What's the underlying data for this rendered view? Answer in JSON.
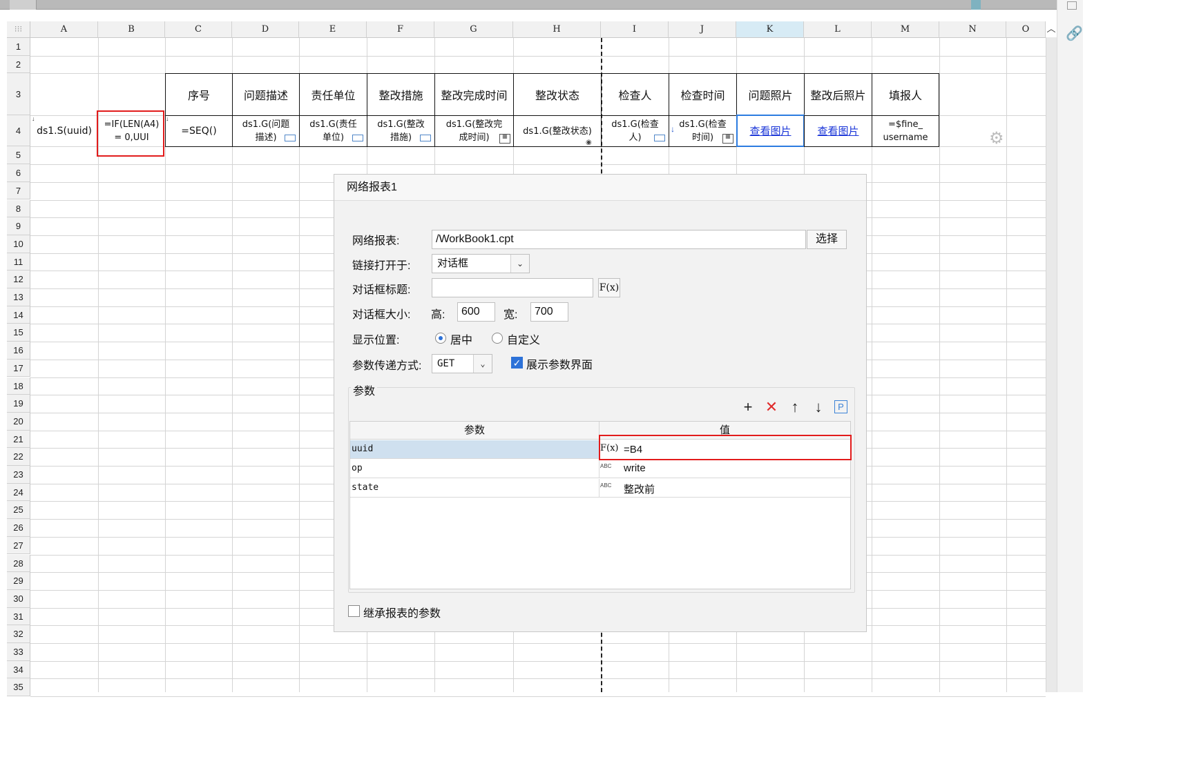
{
  "sheet": {
    "columns": [
      "A",
      "B",
      "C",
      "D",
      "E",
      "F",
      "G",
      "H",
      "I",
      "J",
      "K",
      "L",
      "M",
      "N",
      "O"
    ],
    "rows": [
      "1",
      "2",
      "3",
      "4",
      "5",
      "6",
      "7",
      "8",
      "9",
      "10",
      "11",
      "12",
      "13",
      "14",
      "15",
      "16",
      "17",
      "18",
      "19",
      "20",
      "21",
      "22",
      "23",
      "24",
      "25",
      "26",
      "27",
      "28",
      "29",
      "30",
      "31",
      "32",
      "33",
      "34",
      "35"
    ],
    "header_row": {
      "c": "序号",
      "d": "问题描述",
      "e": "责任单位",
      "f": "整改措施",
      "g": "整改完成时间",
      "h": "整改状态",
      "i": "检查人",
      "j": "检查时间",
      "k": "问题照片",
      "l": "整改后照片",
      "m": "填报人"
    },
    "data_row": {
      "a": "ds1.S(uuid)",
      "b_line1": "=IF(LEN(A4)",
      "b_line2": "= 0,UUI",
      "c": "=SEQ()",
      "d_line1": "ds1.G(问题",
      "d_line2": "描述)",
      "e_line1": "ds1.G(责任",
      "e_line2": "单位)",
      "f_line1": "ds1.G(整改",
      "f_line2": "措施)",
      "g_line1": "ds1.G(整改完",
      "g_line2": "成时间)",
      "h": "ds1.G(整改状态)",
      "i_line1": "ds1.G(检查",
      "i_line2": "人)",
      "j_line1": "ds1.G(检查",
      "j_line2": "时间)",
      "k": "查看图片",
      "l": "查看图片",
      "m_line1": "=$fine_",
      "m_line2": "username"
    }
  },
  "dialog": {
    "title": "网络报表1",
    "report_label": "网络报表:",
    "report_value": "/WorkBook1.cpt",
    "select_button": "选择",
    "open_in_label": "链接打开于:",
    "open_in_value": "对话框",
    "dialog_title_label": "对话框标题:",
    "dialog_title_value": "",
    "formula_button": "F(x)",
    "size_label": "对话框大小:",
    "height_label": "高:",
    "height_value": "600",
    "width_label": "宽:",
    "width_value": "700",
    "position_label": "显示位置:",
    "position_center": "居中",
    "position_custom": "自定义",
    "param_method_label": "参数传递方式:",
    "param_method_value": "GET",
    "show_param_ui": "展示参数界面",
    "params_group": "参数",
    "params_table": {
      "col_param": "参数",
      "col_value": "值",
      "rows": [
        {
          "name": "uuid",
          "type_icon": "F(x)",
          "value": "=B4"
        },
        {
          "name": "op",
          "type_icon": "ABC",
          "value": "write"
        },
        {
          "name": "state",
          "type_icon": "ABC",
          "value": "整改前"
        }
      ]
    },
    "inherit_params": "继承报表的参数",
    "toolbar": {
      "add": "+",
      "delete": "✕",
      "up": "↑",
      "down": "↓",
      "param": "P"
    }
  },
  "colors": {
    "highlight_red": "#e21b1b",
    "selection_blue": "#2b7be0",
    "link_blue": "#1a35d8"
  }
}
